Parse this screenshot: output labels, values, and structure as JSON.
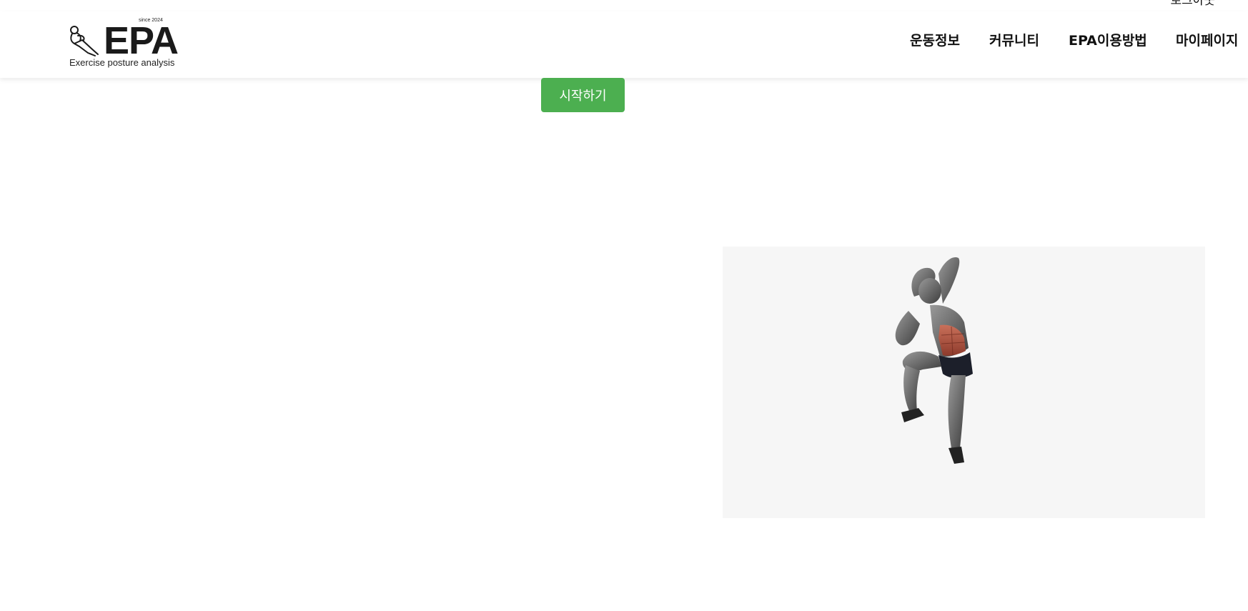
{
  "topbar": {
    "logout_label": "로그아웃"
  },
  "logo": {
    "since": "since 2024",
    "wordmark": "EPA",
    "tagline": "Exercise posture analysis"
  },
  "nav": {
    "items": [
      {
        "label": "운동정보"
      },
      {
        "label": "커뮤니티"
      },
      {
        "label": "EPA이용방법"
      },
      {
        "label": "마이페이지"
      }
    ]
  },
  "main": {
    "start_button_label": "시작하기"
  },
  "colors": {
    "start_button": "#4caf50",
    "panel_background": "#f6f6f6",
    "highlight_muscle": "#b5523c"
  },
  "illustration": {
    "icon": "exercise-standing-crunch-illustration",
    "highlighted_muscle": "abdominals"
  }
}
